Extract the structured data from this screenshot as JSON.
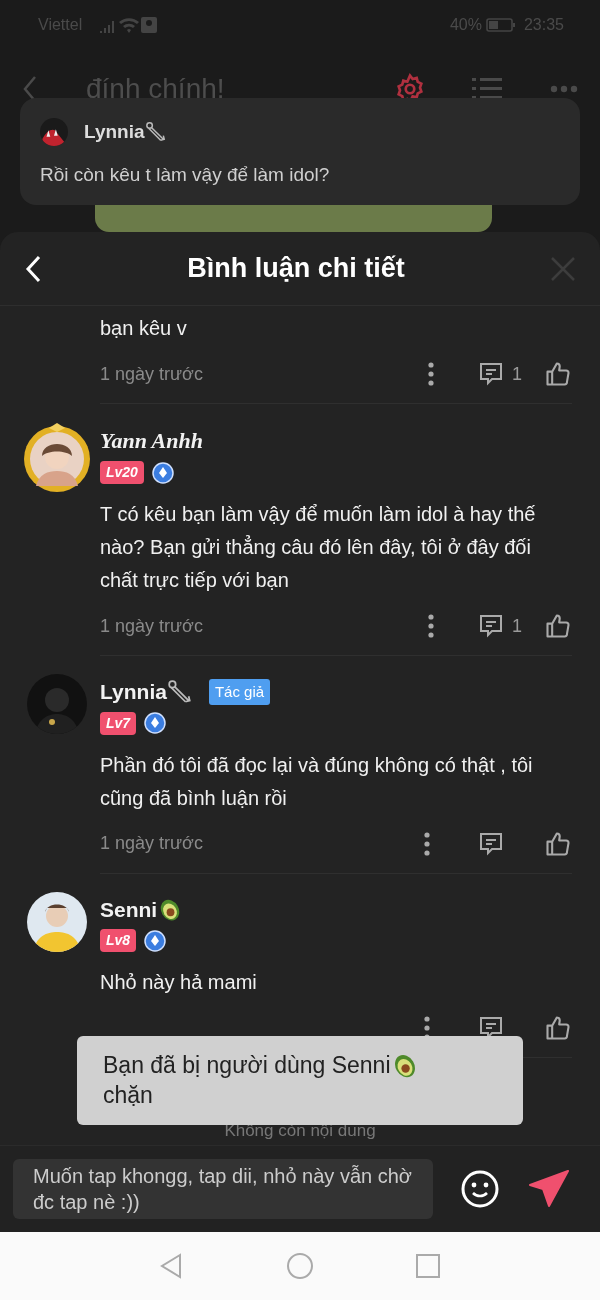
{
  "status_bar": {
    "carrier": "Viettel",
    "battery": "40%",
    "time": "23:35"
  },
  "app_bar": {
    "title": "đính chính!"
  },
  "notification": {
    "user": "Lynnia",
    "message": "Rồi còn kêu t làm vậy để làm idol?"
  },
  "sheet": {
    "title": "Bình luận chi tiết",
    "close_disabled": true
  },
  "comments": [
    {
      "kind": "continued",
      "text": "bạn kêu v",
      "time": "1 ngày trước",
      "reply_count": "1"
    },
    {
      "kind": "vip",
      "user": "Yann Anhh",
      "rank": "Lv20",
      "text": "T có kêu bạn làm vậy để muốn làm idol à hay thế nào? Bạn gửi thẳng câu đó lên đây, tôi ở đây đối chất trực tiếp với bạn",
      "time": "1 ngày trước",
      "reply_count": "1"
    },
    {
      "kind": "member",
      "user": "Lynnia",
      "author_tag": "Tác giả",
      "rank": "Lv7",
      "text": "Phần đó tôi đã đọc lại và đúng không có thật , tôi cũng đã bình luận rồi",
      "time": "1 ngày trước"
    },
    {
      "kind": "member",
      "user": "Senni",
      "rank": "Lv8",
      "text": "Nhỏ này hả mami"
    }
  ],
  "end_note": "Không còn nội dung",
  "toast": {
    "text": "Bạn đã bị người dùng Senni",
    "text_after": "chặn"
  },
  "composer": {
    "value": "Muốn tap khongg, tap dii, nhỏ này vẫn chờ đc tap nè :))"
  }
}
